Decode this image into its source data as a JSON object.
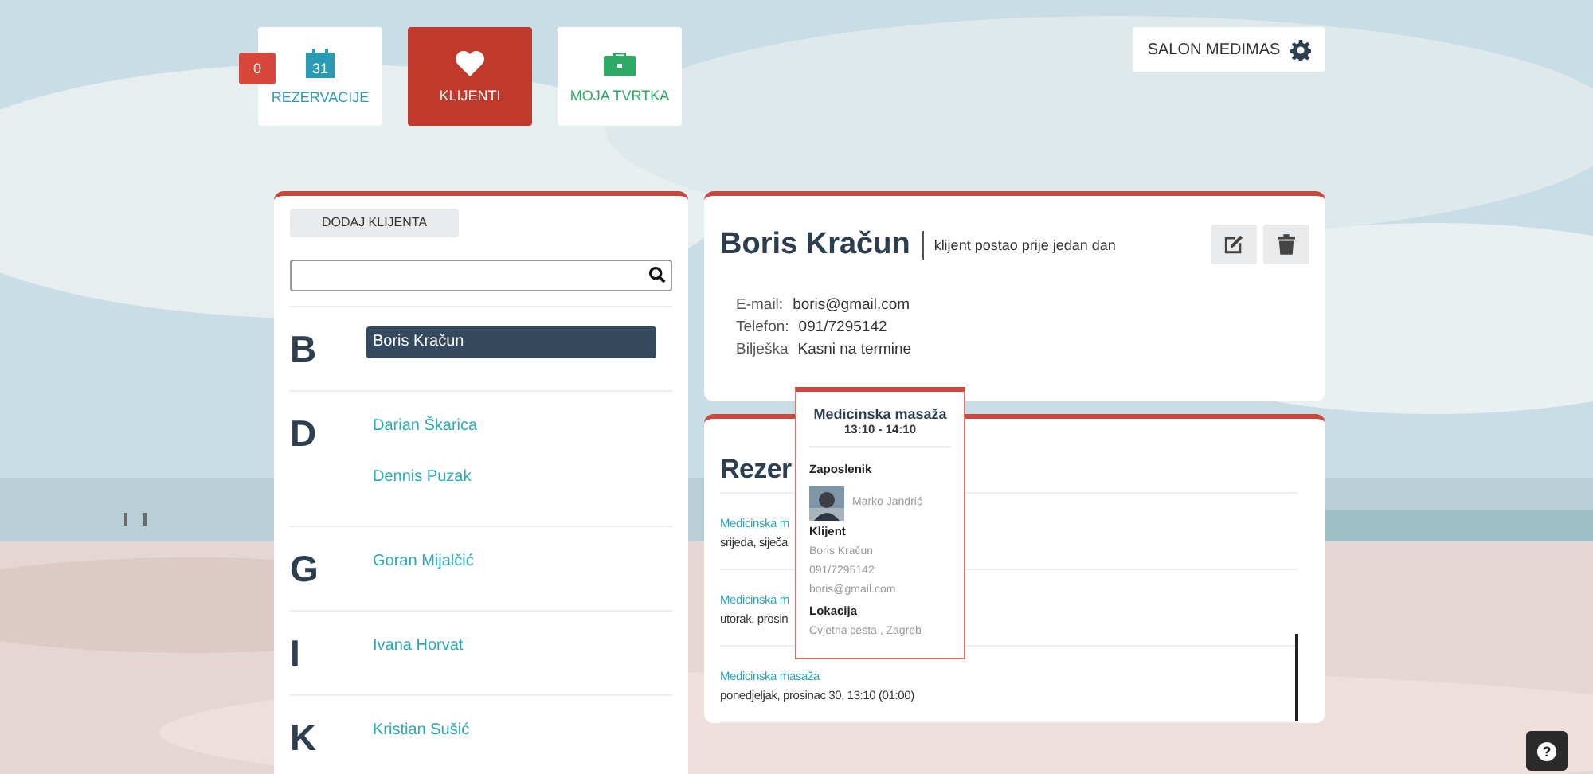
{
  "nav": [
    {
      "label": "REZERVACIJE",
      "kind": "calendar",
      "calendar_day": "31",
      "color": "#2a9bb5",
      "selected": false,
      "badge": "0"
    },
    {
      "label": "KLIJENTI",
      "kind": "heart",
      "color": "#ffffff",
      "selected": true
    },
    {
      "label": "MOJA TVRTKA",
      "kind": "briefcase",
      "color": "#2eaa66",
      "selected": false
    }
  ],
  "salon_button": "SALON MEDIMAS",
  "clients": {
    "add_button": "DODAJ KLIJENTA",
    "groups": [
      {
        "letter": "B",
        "clients": [
          {
            "name": "Boris Kračun",
            "selected": true
          }
        ]
      },
      {
        "letter": "D",
        "clients": [
          {
            "name": "Darian Škarica",
            "selected": false
          },
          {
            "name": "Dennis Puzak",
            "selected": false
          }
        ]
      },
      {
        "letter": "G",
        "clients": [
          {
            "name": "Goran Mijalčić",
            "selected": false
          }
        ]
      },
      {
        "letter": "I",
        "clients": [
          {
            "name": "Ivana Horvat",
            "selected": false
          }
        ]
      },
      {
        "letter": "K",
        "clients": [
          {
            "name": "Kristian Sušić",
            "selected": false
          }
        ]
      }
    ]
  },
  "detail": {
    "name": "Boris Kračun",
    "subtitle": "klijent postao prije jedan dan",
    "fields": [
      {
        "label": "E-mail:",
        "value": "boris@gmail.com"
      },
      {
        "label": "Telefon:",
        "value": "091/7295142"
      },
      {
        "label": "Bilješka",
        "value": "Kasni na termine"
      }
    ]
  },
  "reservations": {
    "title": "Rezer",
    "items": [
      {
        "service": "Medicinska m",
        "when": "srijeda, siječa"
      },
      {
        "service": "Medicinska m",
        "when": "utorak, prosin"
      },
      {
        "service": "Medicinska masaža",
        "when": "ponedjeljak, prosinac 30, 13:10 (01:00)"
      }
    ]
  },
  "popup": {
    "title": "Medicinska masaža",
    "time": "13:10 - 14:10",
    "employee_label": "Zaposlenik",
    "employee": "Marko Jandrić",
    "client_label": "Klijent",
    "client_lines": [
      "Boris Kračun",
      "091/7295142",
      "boris@gmail.com"
    ],
    "location_label": "Lokacija",
    "location": "Cvjetna cesta , Zagreb"
  },
  "help_button": "?"
}
